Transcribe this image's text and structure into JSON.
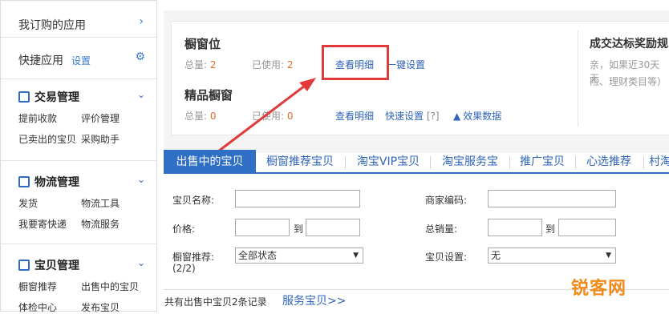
{
  "sidebar": {
    "subscribed": "我订购的应用",
    "quick_apps": "快捷应用",
    "settings_link": "设置",
    "trade": {
      "title": "交易管理",
      "links": [
        "提前收款",
        "评价管理",
        "已卖出的宝贝",
        "采购助手"
      ]
    },
    "logistics": {
      "title": "物流管理",
      "links": [
        "发货",
        "物流工具",
        "我要寄快递",
        "物流服务"
      ]
    },
    "items": {
      "title": "宝贝管理",
      "links": [
        "橱窗推荐",
        "出售中的宝贝",
        "体检中心",
        "发布宝贝"
      ]
    }
  },
  "window": {
    "title": "橱窗位",
    "total_label": "总量:",
    "total_value": "2",
    "used_label": "已使用:",
    "used_value": "2",
    "view_detail": "查看明细",
    "one_click": "一键设置"
  },
  "premium": {
    "title": "精品橱窗",
    "total_label": "总量:",
    "total_value": "0",
    "used_label": "已使用:",
    "used_value": "0",
    "view_detail": "查看明细",
    "quick_set": "快速设置",
    "help": "[?]",
    "effect_data": "效果数据"
  },
  "reward": {
    "title": "成交达标奖励规",
    "line1": "亲，如果近30天无",
    "line2": "险、理财类目等）"
  },
  "tabs": [
    "出售中的宝贝",
    "橱窗推荐宝贝",
    "淘宝VIP宝贝",
    "淘宝服务宝",
    "推广宝贝",
    "心选推荐",
    "村淘"
  ],
  "filters": {
    "name_label": "宝贝名称:",
    "merchant_code_label": "商家编码:",
    "price_label": "价格:",
    "to1": "到",
    "total_sales_label": "总销量:",
    "to2": "到",
    "window_rec_label": "橱窗推荐:",
    "window_rec_count": "(2/2)",
    "window_rec_value": "全部状态",
    "item_setting_label": "宝贝设置:",
    "item_setting_value": "无"
  },
  "footer": {
    "count_text": "共有出售中宝贝2条记录",
    "service_link": "服务宝贝>>"
  },
  "watermark": "锐客网",
  "colors": {
    "accent": "#2f6fc6",
    "highlight_box": "#e03a3a",
    "number": "#e06b2b"
  }
}
